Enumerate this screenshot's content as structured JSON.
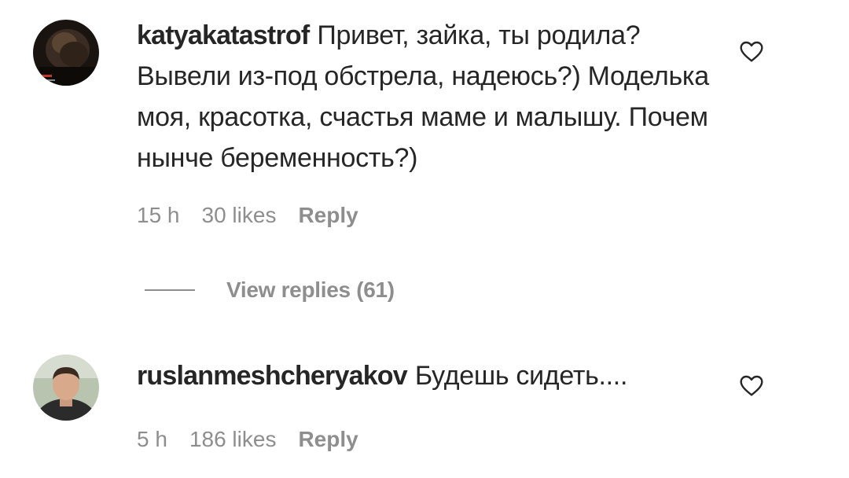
{
  "comments": [
    {
      "username": "katyakatastrof",
      "text": "Привет, зайка, ты родила? Вывели из-под обстрела, надеюсь?) Моделька моя, красотка, счастья маме и малышу. Почем нынче беременность?)",
      "time": "15 h",
      "likes": "30 likes",
      "reply_label": "Reply",
      "view_replies": "View replies (61)",
      "avatar_icon": "profile-photo-dark"
    },
    {
      "username": "ruslanmeshcheryakov",
      "text": "Будешь сидеть....",
      "time": "5 h",
      "likes": "186 likes",
      "reply_label": "Reply",
      "avatar_icon": "profile-photo-man"
    }
  ],
  "colors": {
    "text": "#262626",
    "secondary": "#8e8e8e",
    "background": "#ffffff"
  }
}
